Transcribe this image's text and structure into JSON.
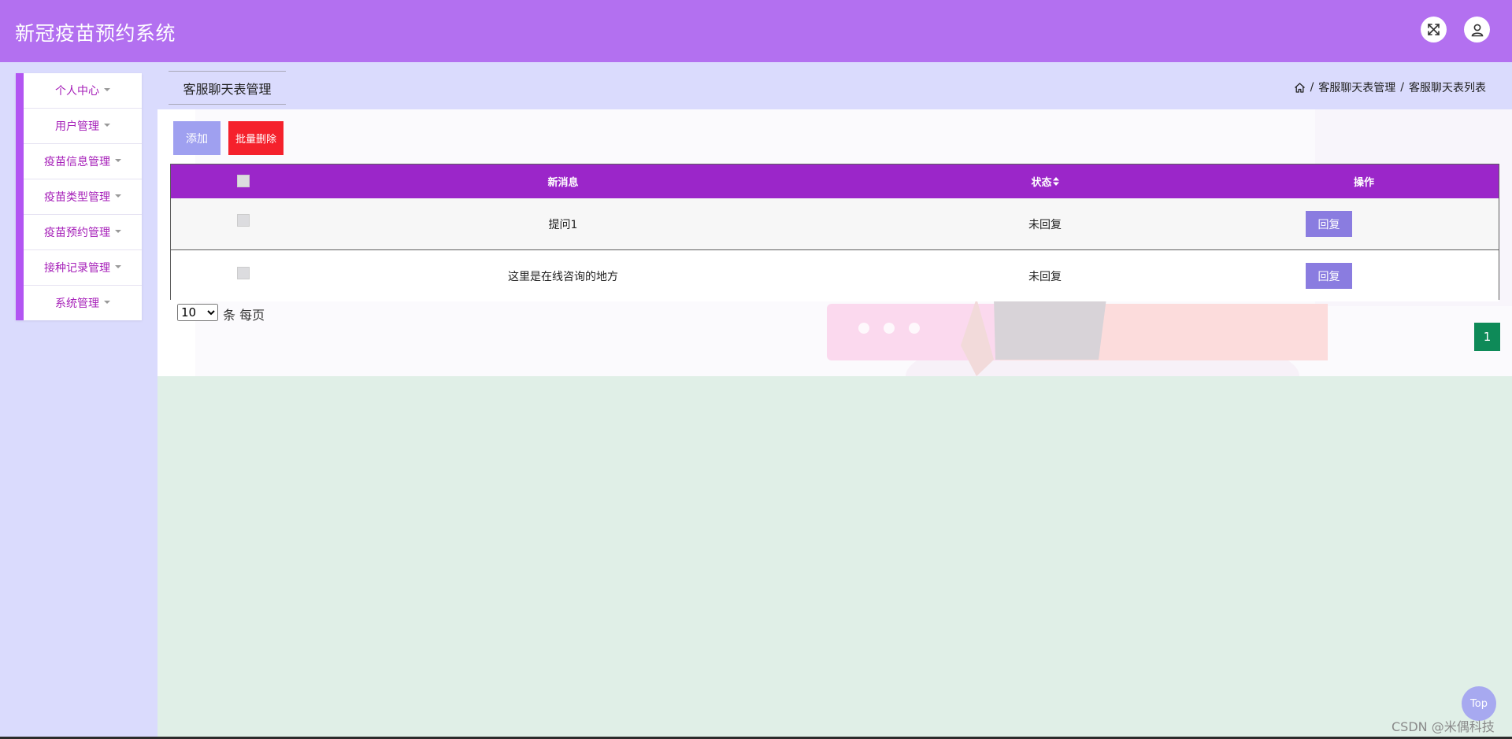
{
  "app": {
    "title": "新冠疫苗预约系统"
  },
  "header": {
    "fullscreen_icon": "expand-icon",
    "user_icon": "user-icon"
  },
  "sidebar": {
    "items": [
      {
        "label": "个人中心"
      },
      {
        "label": "用户管理"
      },
      {
        "label": "疫苗信息管理"
      },
      {
        "label": "疫苗类型管理"
      },
      {
        "label": "疫苗预约管理"
      },
      {
        "label": "接种记录管理"
      },
      {
        "label": "系统管理"
      }
    ]
  },
  "page": {
    "tab_title": "客服聊天表管理",
    "breadcrumb": [
      "客服聊天表管理",
      "客服聊天表列表"
    ]
  },
  "toolbar": {
    "add_label": "添加",
    "batch_delete_label": "批量删除"
  },
  "table": {
    "headers": {
      "message": "新消息",
      "status": "状态",
      "action": "操作"
    },
    "rows": [
      {
        "message": "提问1",
        "status": "未回复",
        "action": "回复"
      },
      {
        "message": "这里是在线咨询的地方",
        "status": "未回复",
        "action": "回复"
      }
    ]
  },
  "pagination": {
    "page_size": "10",
    "page_size_options": [
      "10"
    ],
    "page_size_suffix": "条 每页",
    "current_page": "1"
  },
  "back_to_top": "Top",
  "watermark": "CSDN @米偶科技",
  "colors": {
    "header": "#b370f0",
    "table_header": "#9b26c9",
    "sidebar_accent": "#b255f2",
    "add_button": "#9fa0f0",
    "batch_delete_button": "#f5212c",
    "reply_button": "#8a7ce0",
    "page_active": "#0e8a58"
  }
}
